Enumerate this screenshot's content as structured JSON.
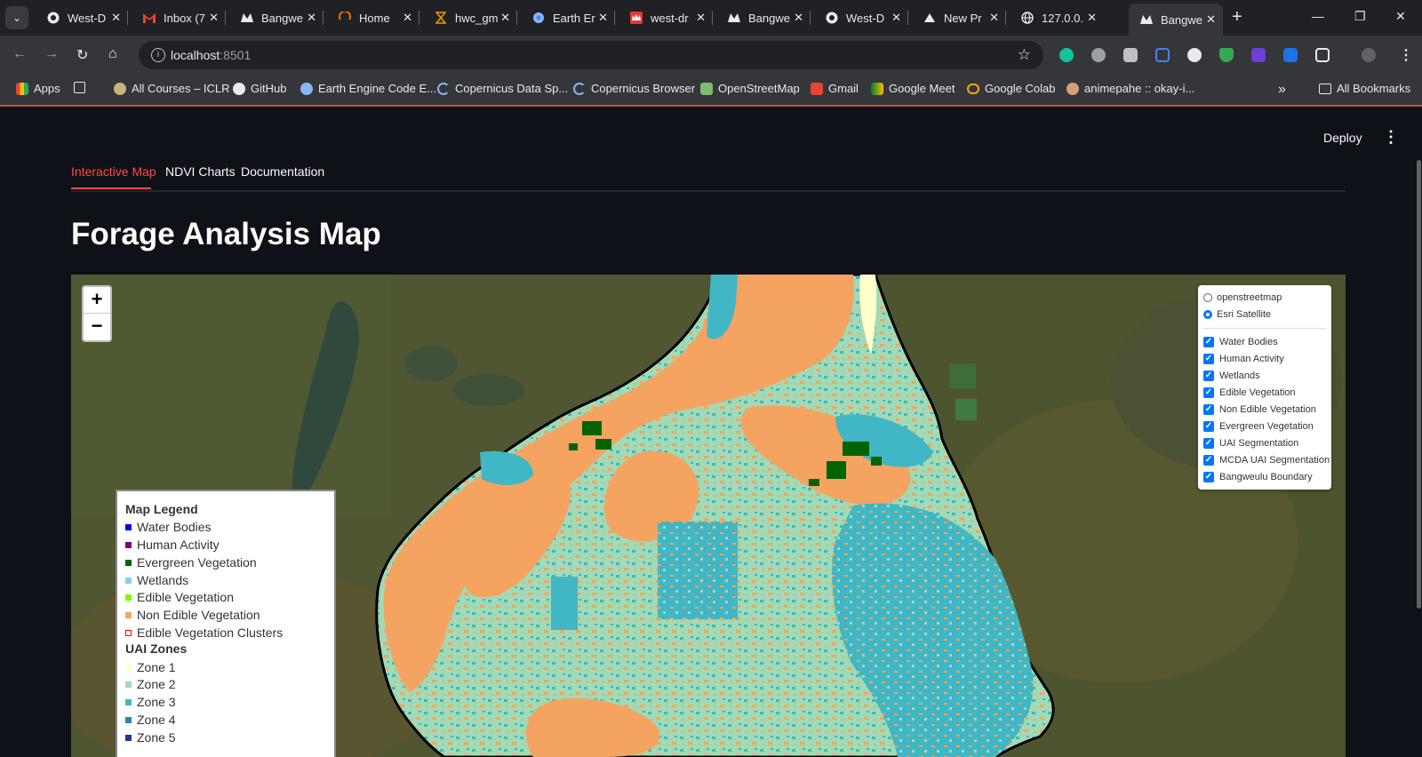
{
  "browser": {
    "tabs": [
      {
        "title": "West-D",
        "icon": "github-icon"
      },
      {
        "title": "Inbox (7",
        "icon": "gmail-icon"
      },
      {
        "title": "Bangwe",
        "icon": "streamlit-icon"
      },
      {
        "title": "Home",
        "icon": "home-ring-icon"
      },
      {
        "title": "hwc_gm",
        "icon": "hourglass-icon"
      },
      {
        "title": "Earth Er",
        "icon": "earth-engine-icon"
      },
      {
        "title": "west-dr",
        "icon": "crown-icon"
      },
      {
        "title": "Bangwe",
        "icon": "streamlit-icon"
      },
      {
        "title": "West-D",
        "icon": "github-icon"
      },
      {
        "title": "New Pr",
        "icon": "vercel-icon"
      },
      {
        "title": "127.0.0.",
        "icon": "globe-icon"
      },
      {
        "title": "Bangwe",
        "icon": "streamlit-icon",
        "active": true
      }
    ],
    "address": {
      "host": "localhost",
      "port": ":8501"
    },
    "bookmarks": [
      {
        "label": "Apps"
      },
      {
        "label": "All Courses – ICLR"
      },
      {
        "label": "GitHub"
      },
      {
        "label": "Earth Engine Code E..."
      },
      {
        "label": "Copernicus Data Sp..."
      },
      {
        "label": "Copernicus Browser"
      },
      {
        "label": "OpenStreetMap"
      },
      {
        "label": "Gmail"
      },
      {
        "label": "Google Meet"
      },
      {
        "label": "Google Colab"
      },
      {
        "label": "animepahe :: okay-i..."
      },
      {
        "label": "All Bookmarks"
      }
    ]
  },
  "app": {
    "deploy_label": "Deploy",
    "tabs": [
      "Interactive Map",
      "NDVI Charts",
      "Documentation"
    ],
    "title": "Forage Analysis Map"
  },
  "map": {
    "base_layers": [
      {
        "label": "openstreetmap",
        "selected": false
      },
      {
        "label": "Esri Satellite",
        "selected": true
      }
    ],
    "overlays": [
      "Water Bodies",
      "Human Activity",
      "Wetlands",
      "Edible Vegetation",
      "Non Edible Vegetation",
      "Evergreen Vegetation",
      "UAI Segmentation",
      "MCDA UAI Segmentation",
      "Bangweulu Boundary"
    ],
    "legend": {
      "title": "Map Legend",
      "items": [
        {
          "label": "Water Bodies",
          "color": "#0000ff"
        },
        {
          "label": "Human Activity",
          "color": "#800080"
        },
        {
          "label": "Evergreen Vegetation",
          "color": "#006400"
        },
        {
          "label": "Wetlands",
          "color": "#87cefa"
        },
        {
          "label": "Edible Vegetation",
          "color": "#7cfc00"
        },
        {
          "label": "Non Edible Vegetation",
          "color": "#f4a460"
        },
        {
          "label": "Edible Vegetation Clusters",
          "color": "#ff0000",
          "outline": true
        }
      ],
      "zones_title": "UAI Zones",
      "zones": [
        {
          "label": "Zone 1",
          "color": "#ffffcc"
        },
        {
          "label": "Zone 2",
          "color": "#a1dab4"
        },
        {
          "label": "Zone 3",
          "color": "#41b6c4"
        },
        {
          "label": "Zone 4",
          "color": "#2c7fb8"
        },
        {
          "label": "Zone 5",
          "color": "#253494"
        }
      ]
    }
  }
}
